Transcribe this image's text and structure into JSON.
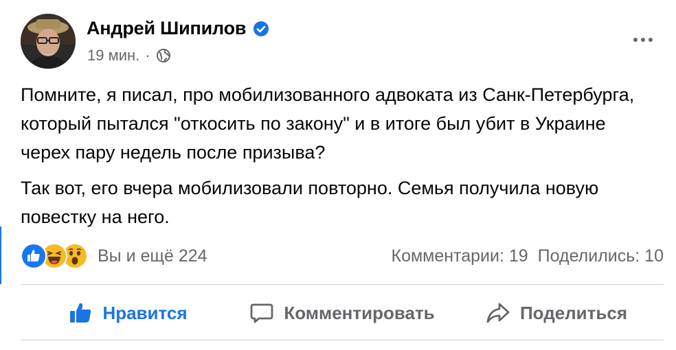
{
  "post": {
    "author": "Андрей Шипилов",
    "time": "19 мин.",
    "meta_separator": "·",
    "paragraphs": [
      "Помните, я писал, про мобилизованного адвоката из Санк-Петербурга, который пытался \"откосить по закону\" и в итоге был убит в Украине черех пару недель после призыва?",
      "Так вот, его вчера мобилизовали повторно. Семья получила новую повестку на него."
    ]
  },
  "reactions": {
    "icons": [
      "like-icon",
      "haha-icon",
      "wow-icon"
    ],
    "summary": "Вы и ещё 224",
    "comments": "Комментарии: 19",
    "shares": "Поделились: 10"
  },
  "actions": {
    "like": "Нравится",
    "comment": "Комментировать",
    "share": "Поделиться"
  },
  "colors": {
    "accent": "#1b74e4",
    "secondary_text": "#65676b",
    "divider": "#ced0d4"
  }
}
